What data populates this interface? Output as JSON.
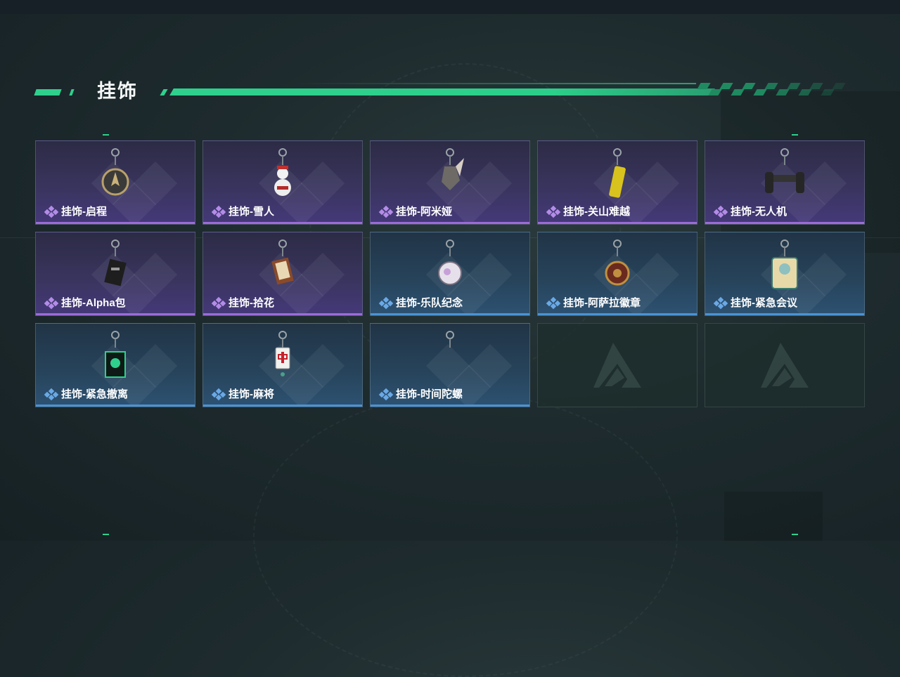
{
  "page": {
    "title": "挂饰"
  },
  "colors": {
    "accent": "#2fd08c",
    "purple_rarity": "#9b6cd8",
    "blue_rarity": "#4b93d4"
  },
  "items": [
    {
      "label": "挂饰-启程",
      "rarity": "purple",
      "icon": "compass-charm-icon"
    },
    {
      "label": "挂饰-雪人",
      "rarity": "purple",
      "icon": "snowman-charm-icon"
    },
    {
      "label": "挂饰-阿米娅",
      "rarity": "purple",
      "icon": "amiya-charm-icon"
    },
    {
      "label": "挂饰-关山难越",
      "rarity": "purple",
      "icon": "gold-bar-charm-icon"
    },
    {
      "label": "挂饰-无人机",
      "rarity": "purple",
      "icon": "drone-charm-icon"
    },
    {
      "label": "挂饰-Alpha包",
      "rarity": "purple",
      "icon": "alpha-pack-charm-icon"
    },
    {
      "label": "挂饰-拾花",
      "rarity": "purple",
      "icon": "flower-frame-charm-icon"
    },
    {
      "label": "挂饰-乐队纪念",
      "rarity": "blue",
      "icon": "band-badge-charm-icon"
    },
    {
      "label": "挂饰-阿萨拉徽章",
      "rarity": "blue",
      "icon": "asala-badge-charm-icon"
    },
    {
      "label": "挂饰-紧急会议",
      "rarity": "blue",
      "icon": "emergency-meeting-charm-icon"
    },
    {
      "label": "挂饰-紧急撤离",
      "rarity": "blue",
      "icon": "evacuation-charm-icon"
    },
    {
      "label": "挂饰-麻将",
      "rarity": "blue",
      "icon": "mahjong-charm-icon"
    },
    {
      "label": "挂饰-时间陀螺",
      "rarity": "blue",
      "icon": "time-gyro-charm-icon"
    }
  ],
  "empty_slots": 2
}
